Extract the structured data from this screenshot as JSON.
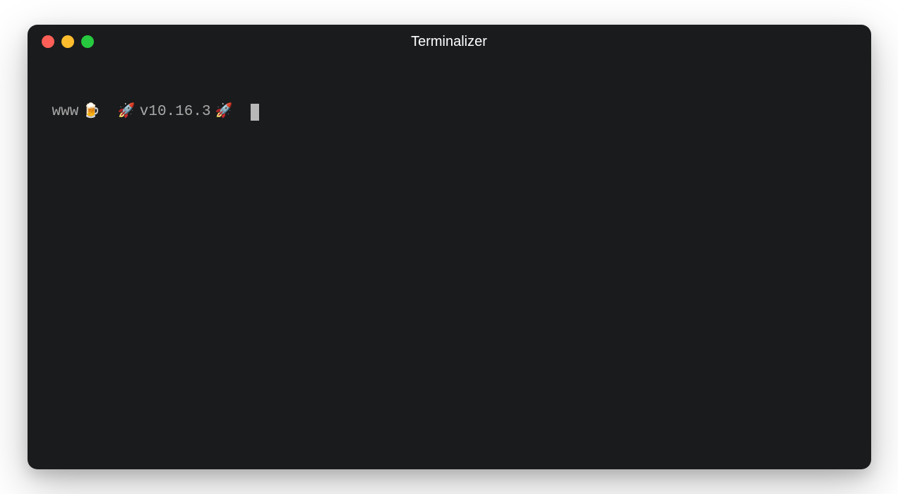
{
  "window": {
    "title": "Terminalizer"
  },
  "prompt": {
    "cwd": "www",
    "icon1": "🍺",
    "icon2": "🚀",
    "version": "v10.16.3",
    "icon3": "🚀"
  }
}
